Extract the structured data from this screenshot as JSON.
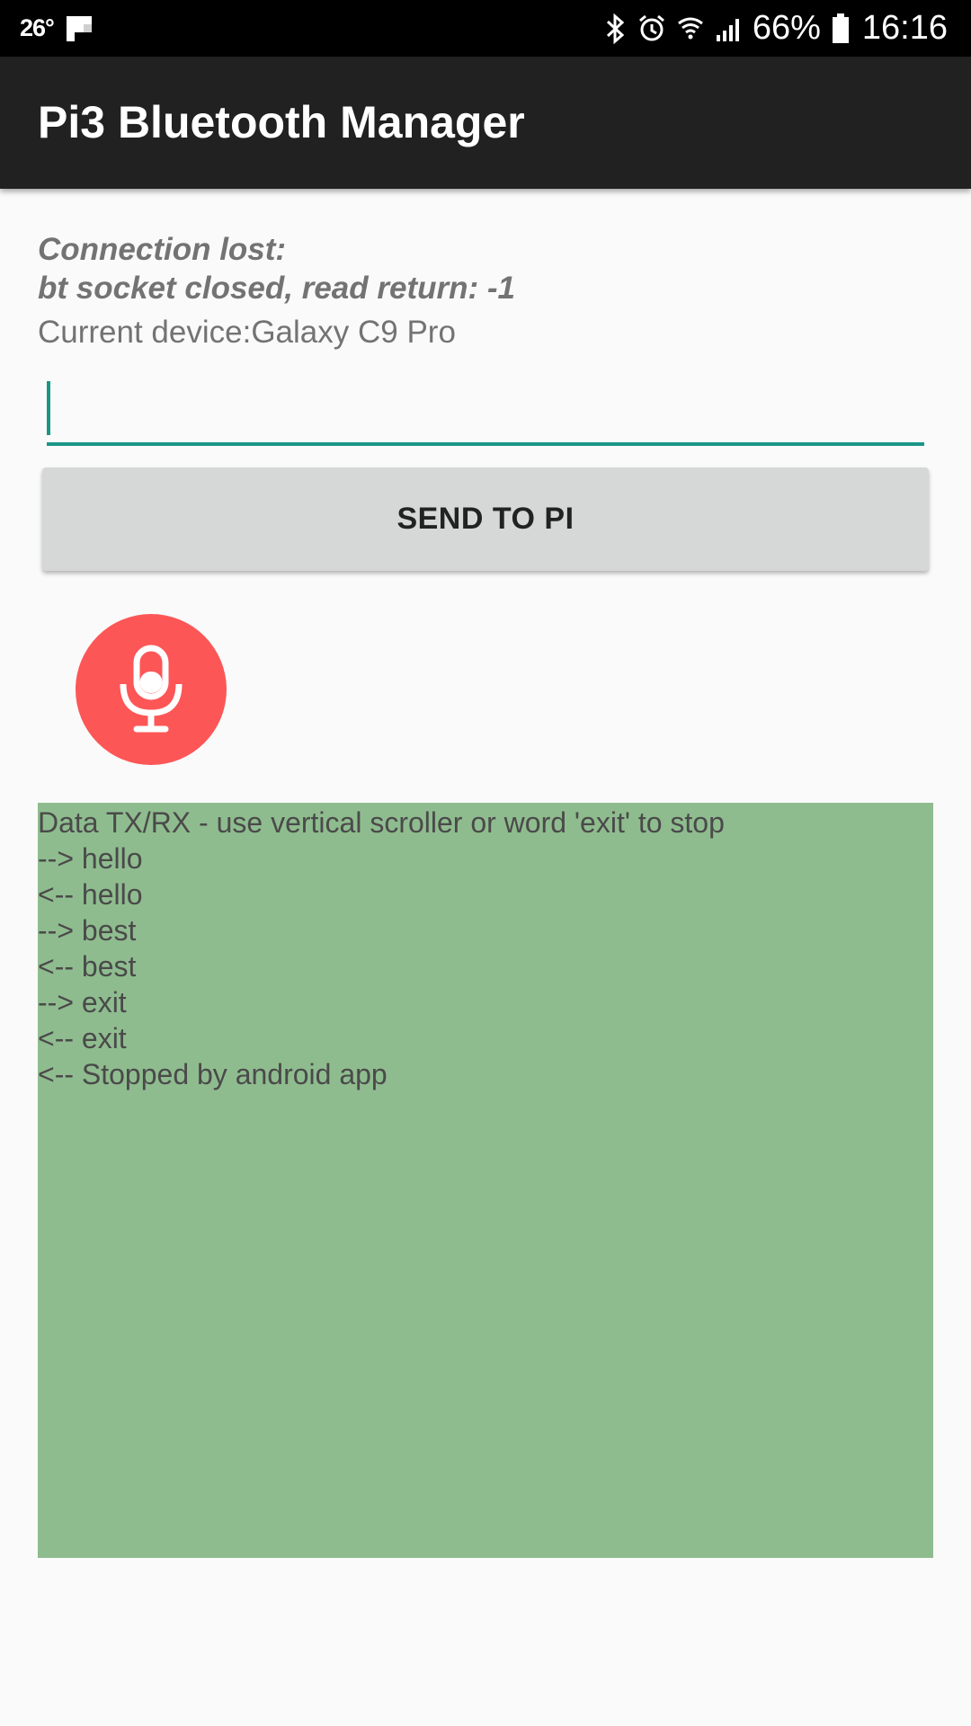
{
  "status_bar": {
    "temperature": "26°",
    "battery": "66%",
    "time": "16:16",
    "icons": [
      "flipboard-icon",
      "bluetooth-icon",
      "alarm-icon",
      "wifi-icon",
      "signal-icon",
      "battery-icon"
    ]
  },
  "app_bar": {
    "title": "Pi3 Bluetooth Manager"
  },
  "connection": {
    "line1": "Connection lost:",
    "line2": "bt socket closed, read return: -1"
  },
  "device": {
    "label": "Current device:Galaxy C9 Pro"
  },
  "input": {
    "value": ""
  },
  "send_button": {
    "label": "SEND TO PI"
  },
  "mic": {
    "icon": "microphone-icon",
    "color": "#fd5656"
  },
  "log": {
    "header": "Data TX/RX - use vertical scroller or word 'exit' to stop",
    "lines": [
      "--> hello",
      "<-- hello",
      "--> best",
      "<-- best",
      "--> exit",
      "<-- exit",
      "<-- Stopped by android app"
    ],
    "background": "#8fbc8f"
  },
  "colors": {
    "app_bar": "#212121",
    "accent": "#1a9688",
    "button": "#d6d7d7"
  }
}
